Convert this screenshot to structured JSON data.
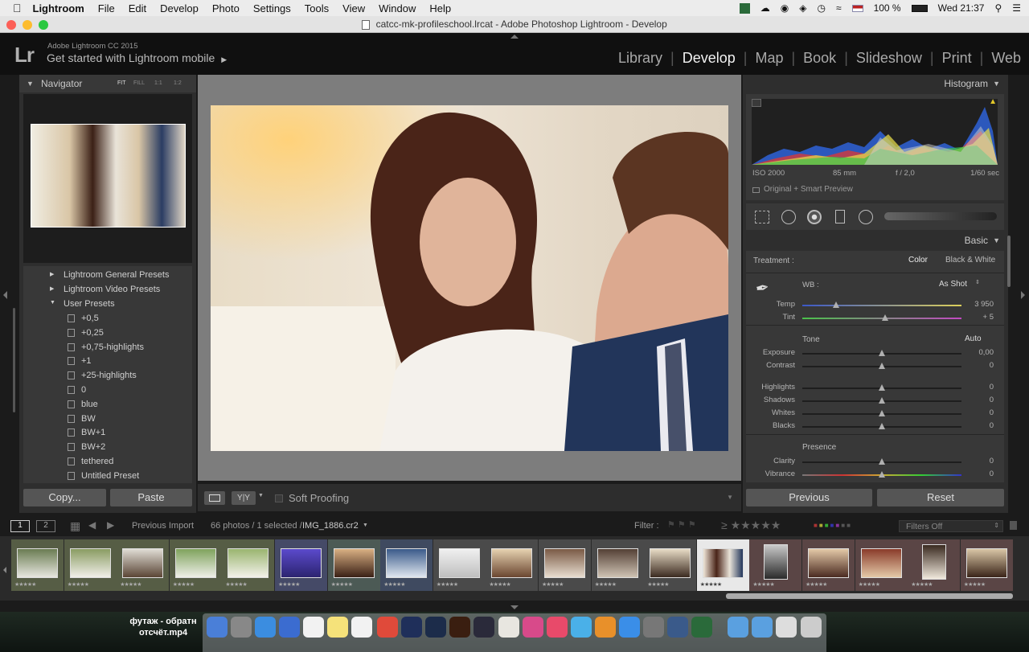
{
  "menubar": {
    "items": [
      "Lightroom",
      "File",
      "Edit",
      "Develop",
      "Photo",
      "Settings",
      "Tools",
      "View",
      "Window",
      "Help"
    ],
    "battery": "100 %",
    "clock": "Wed 21:37"
  },
  "window": {
    "title": "catcc-mk-profileschool.lrcat - Adobe Photoshop Lightroom - Develop"
  },
  "identity": {
    "product": "Adobe Lightroom CC 2015",
    "mobile": "Get started with Lightroom mobile"
  },
  "modules": [
    "Library",
    "Develop",
    "Map",
    "Book",
    "Slideshow",
    "Print",
    "Web"
  ],
  "navigator": {
    "title": "Navigator",
    "zoom": [
      "FIT",
      "FILL",
      "1:1",
      "1:2"
    ]
  },
  "presets": {
    "folders": [
      "Lightroom General Presets",
      "Lightroom Video Presets",
      "User Presets"
    ],
    "items": [
      "+0,5",
      "+0,25",
      "+0,75-highlights",
      "+1",
      "+25-highlights",
      "0",
      "blue",
      "BW",
      "BW+1",
      "BW+2",
      "tethered",
      "Untitled Preset"
    ]
  },
  "left_buttons": {
    "copy": "Copy...",
    "paste": "Paste"
  },
  "toolbar": {
    "soft_proofing": "Soft Proofing"
  },
  "histogram": {
    "title": "Histogram",
    "iso": "ISO 2000",
    "focal": "85 mm",
    "aperture": "f / 2,0",
    "shutter": "1/60 sec",
    "preview": "Original + Smart Preview"
  },
  "basic": {
    "title": "Basic",
    "treatment_label": "Treatment :",
    "treatment_color": "Color",
    "treatment_bw": "Black & White",
    "wb_label": "WB :",
    "wb_value": "As Shot",
    "tone_label": "Tone",
    "auto": "Auto",
    "presence_label": "Presence",
    "sliders": [
      {
        "label": "Temp",
        "value": "3 950",
        "pos": 0.21
      },
      {
        "label": "Tint",
        "value": "+ 5",
        "pos": 0.52
      },
      {
        "label": "Exposure",
        "value": "0,00",
        "pos": 0.5
      },
      {
        "label": "Contrast",
        "value": "0",
        "pos": 0.5
      },
      {
        "label": "Highlights",
        "value": "0",
        "pos": 0.5
      },
      {
        "label": "Shadows",
        "value": "0",
        "pos": 0.5
      },
      {
        "label": "Whites",
        "value": "0",
        "pos": 0.5
      },
      {
        "label": "Blacks",
        "value": "0",
        "pos": 0.5
      },
      {
        "label": "Clarity",
        "value": "0",
        "pos": 0.5
      },
      {
        "label": "Vibrance",
        "value": "0",
        "pos": 0.5
      }
    ]
  },
  "right_buttons": {
    "previous": "Previous",
    "reset": "Reset"
  },
  "filmbar": {
    "page1": "1",
    "page2": "2",
    "source": "Previous Import",
    "count": "66 photos / 1 selected /",
    "filename": "IMG_1886.cr2",
    "filter_label": "Filter :",
    "filters_off": "Filters Off"
  },
  "dock": {
    "video_title_line1": "футаж - обратн",
    "video_title_line2": "отсчёт.mp4"
  },
  "colors": {
    "accent_bg": "#1b1b1b",
    "panel": "#383838",
    "selected_thumb": "#e8e8e8"
  }
}
